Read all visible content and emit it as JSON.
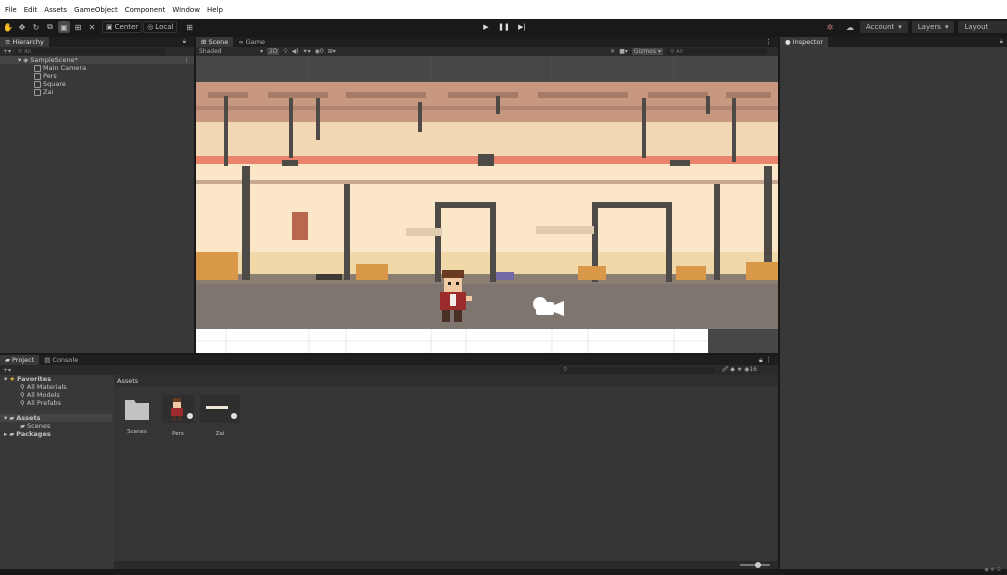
{
  "menu": [
    "File",
    "Edit",
    "Assets",
    "GameObject",
    "Component",
    "Window",
    "Help"
  ],
  "toolbar": {
    "center_label": "Center",
    "local_label": "Local",
    "account_label": "Account",
    "layers_label": "Layers",
    "layout_label": "Layout"
  },
  "hierarchy": {
    "tab": "Hierarchy",
    "search_placeholder": "All",
    "scene_name": "SampleScene*",
    "objects": [
      "Main Camera",
      "Pers",
      "Square",
      "Zai"
    ]
  },
  "scene": {
    "tab_scene": "Scene",
    "tab_game": "Game",
    "shading": "Shaded",
    "mode_2d": "2D",
    "gizmos": "Gizmos",
    "search_placeholder": "All"
  },
  "inspector": {
    "tab": "Inspector"
  },
  "project": {
    "tab_project": "Project",
    "tab_console": "Console",
    "favorites_label": "Favorites",
    "favorites": [
      "All Materials",
      "All Models",
      "All Prefabs"
    ],
    "assets_label": "Assets",
    "assets_children": [
      "Scenes"
    ],
    "packages_label": "Packages",
    "breadcrumb": "Assets",
    "items": [
      "Scenes",
      "Pers",
      "Zai"
    ],
    "count": "16"
  },
  "colors": {
    "accent": "#2c5d87",
    "panel": "#383838",
    "wall": "#fbe7c8",
    "beam": "#4e4a47",
    "floor": "#7d756e",
    "stripe": "#e9836b"
  }
}
